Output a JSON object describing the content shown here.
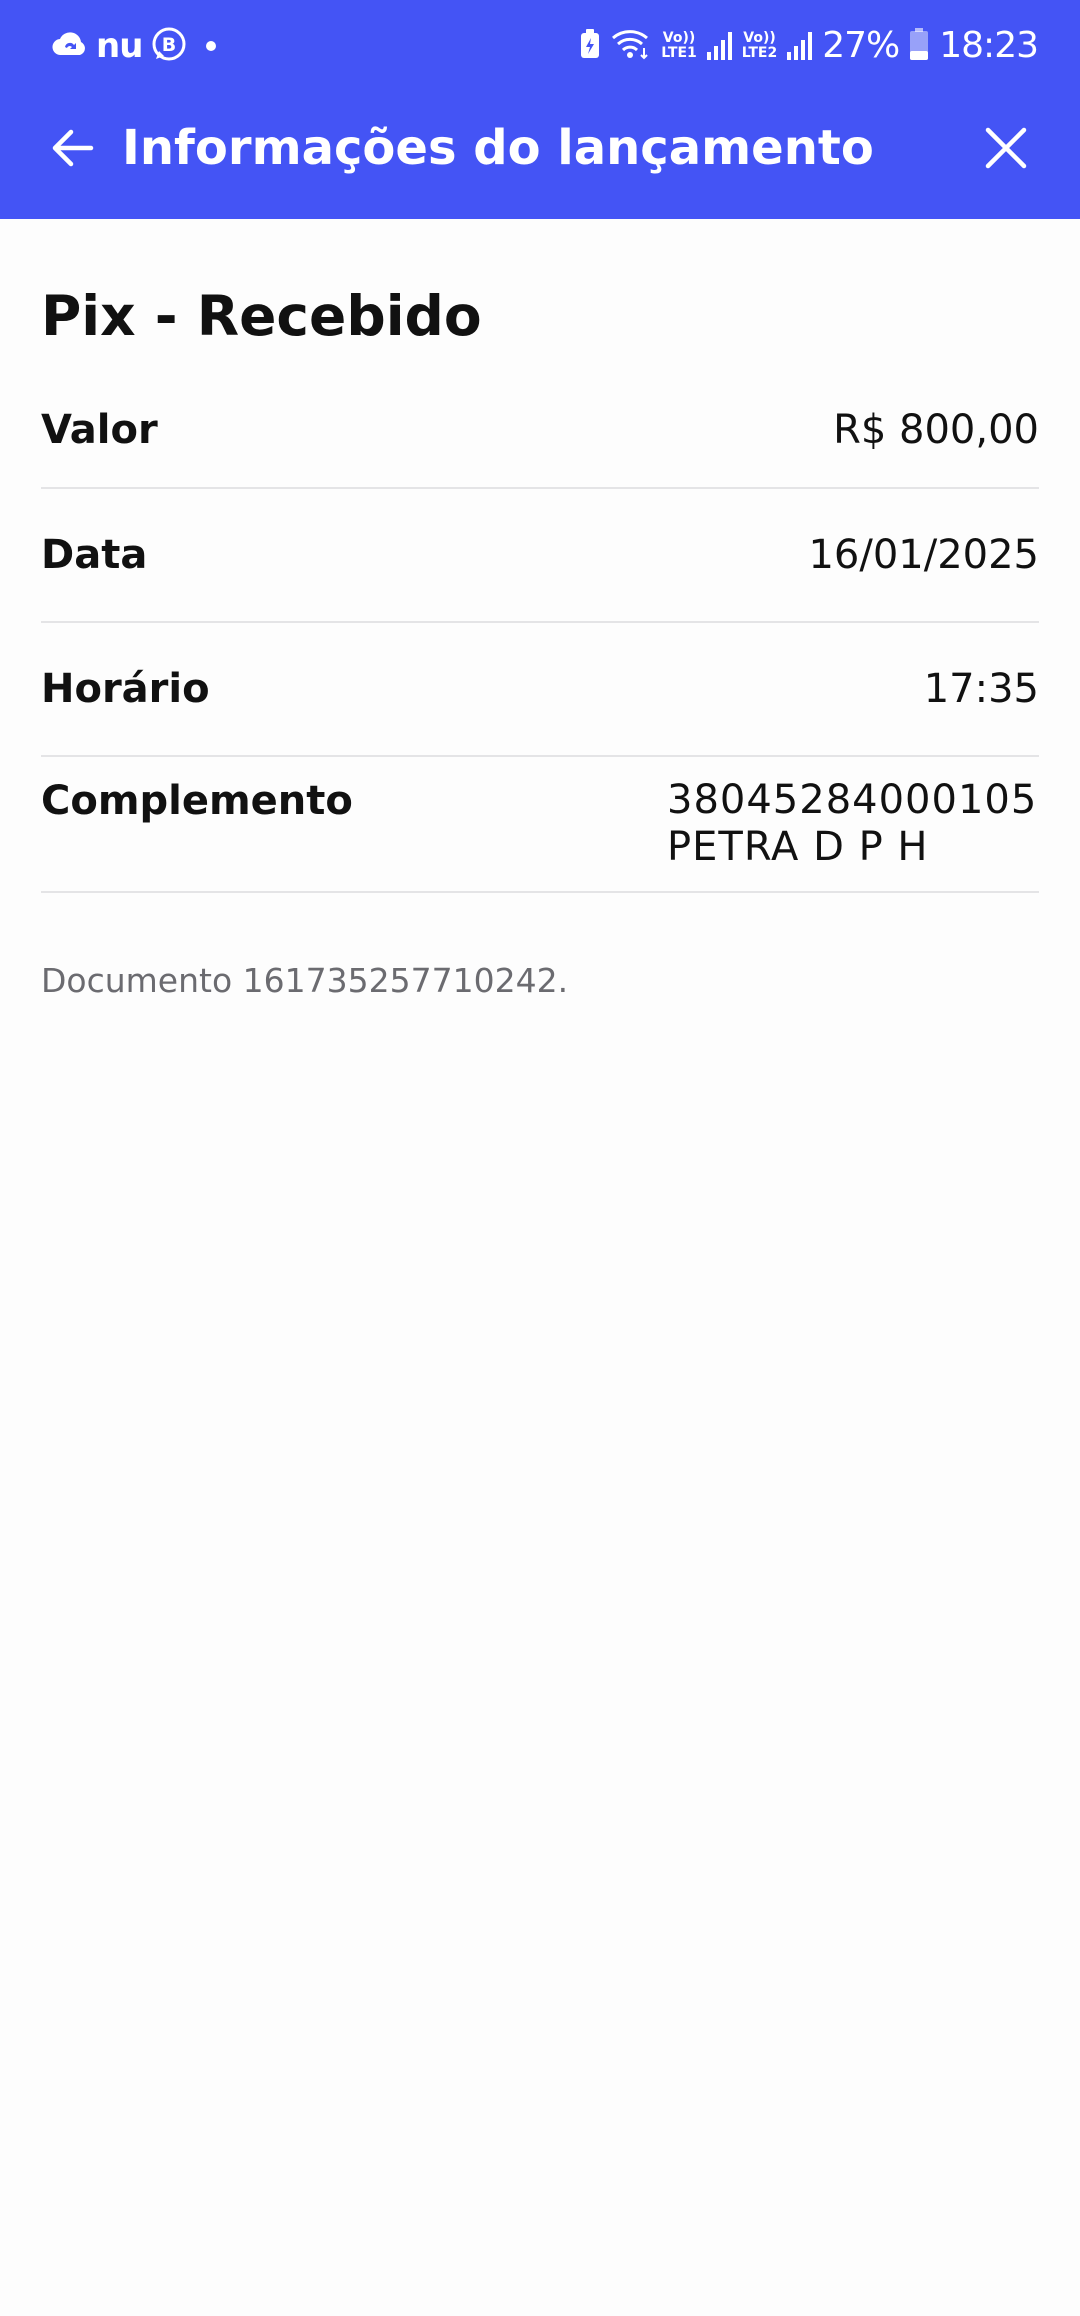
{
  "status_bar": {
    "app_icons": [
      "cloud-sync-icon",
      "nubank-logo",
      "whatsapp-business-icon"
    ],
    "nu_text": "nu",
    "lte1": [
      "Vo))",
      "LTE1"
    ],
    "lte2": [
      "Vo))",
      "LTE2"
    ],
    "battery_percent": "27%",
    "time": "18:23"
  },
  "header": {
    "title": "Informações do lançamento",
    "background_color": "#4454f5"
  },
  "transaction": {
    "title": "Pix - Recebido",
    "rows": [
      {
        "label": "Valor",
        "value": "R$ 800,00"
      },
      {
        "label": "Data",
        "value": "16/01/2025"
      },
      {
        "label": "Horário",
        "value": "17:35"
      },
      {
        "label": "Complemento",
        "value_lines": [
          "38045284000105",
          "PETRA D P H"
        ]
      }
    ],
    "document_note": "Documento 161735257710242."
  }
}
